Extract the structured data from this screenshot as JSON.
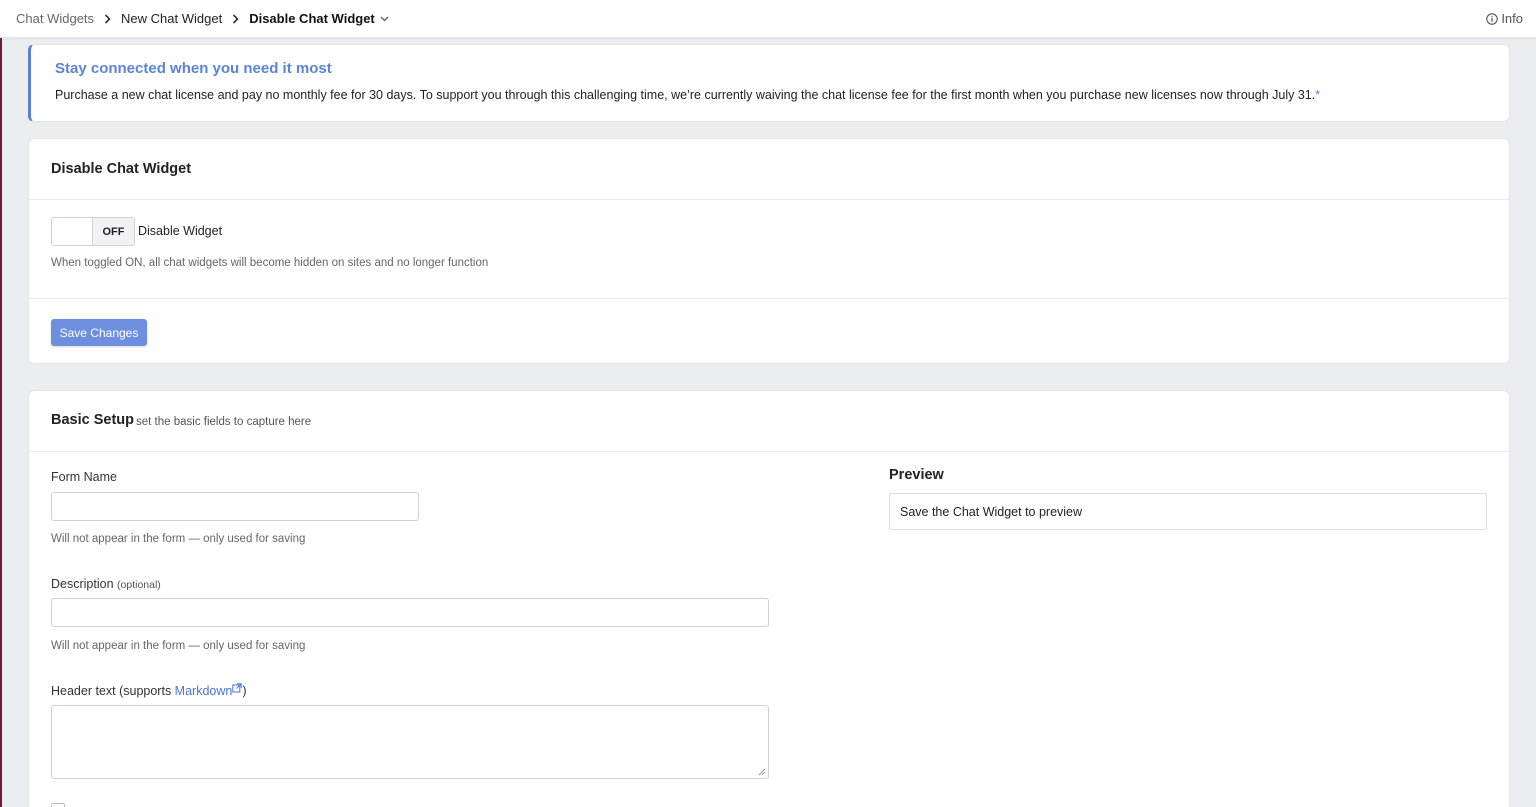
{
  "breadcrumb": {
    "items": [
      "Chat Widgets",
      "New Chat Widget",
      "Disable Chat Widget"
    ]
  },
  "header": {
    "info_label": "Info"
  },
  "notice": {
    "title": "Stay connected when you need it most",
    "text": "Purchase a new chat license and pay no monthly fee for 30 days. To support you through this challenging time, we’re currently waiving the chat license fee for the first month when you purchase new licenses now through July 31.",
    "asterisk": "*"
  },
  "disable_card": {
    "title": "Disable Chat Widget",
    "toggle_state": "OFF",
    "toggle_label": "Disable Widget",
    "hint": "When toggled ON, all chat widgets will become hidden on sites and no longer function",
    "save_label": "Save Changes"
  },
  "basic_setup": {
    "title": "Basic Setup",
    "subtitle": "set the basic fields to capture here",
    "form_name_label": "Form Name",
    "form_name_value": "",
    "form_name_hint": "Will not appear in the form — only used for saving",
    "description_label": "Description",
    "description_optional": "(optional)",
    "description_value": "",
    "description_hint": "Will not appear in the form — only used for saving",
    "header_text_label": "Header text (supports ",
    "header_text_link": "Markdown",
    "header_text_close": ")",
    "preview_title": "Preview",
    "preview_text": "Save the Chat Widget to preview"
  },
  "colors": {
    "accent": "#5b84d8",
    "button": "#6e8fe0",
    "background": "#ecedf1"
  }
}
